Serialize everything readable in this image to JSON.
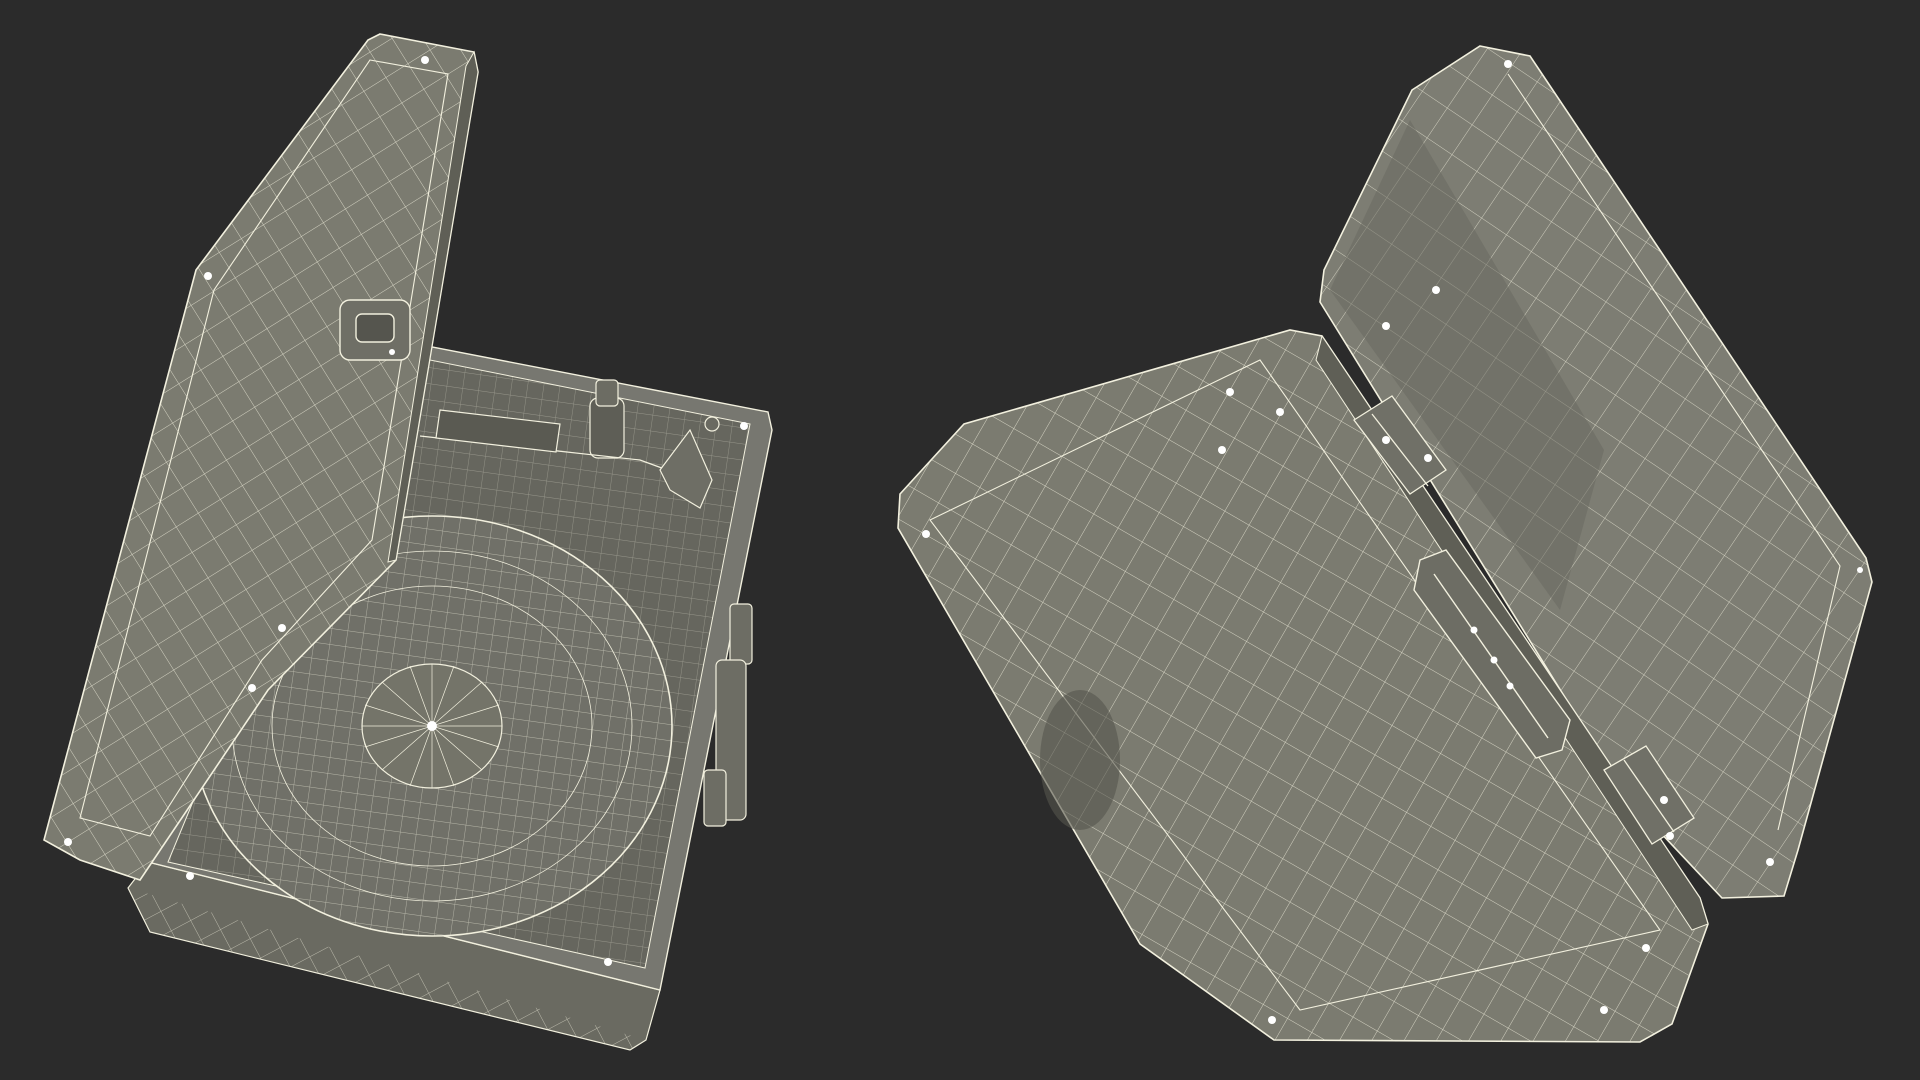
{
  "scene": {
    "background": "#2b2b2b",
    "surface_color": "#7b7b70",
    "surface_shadow": "#5f5f56",
    "surface_dark": "#4e4e47",
    "wire_color": "#f2f0de",
    "screw_color": "#ffffff"
  },
  "objects": [
    {
      "name": "open-turntable-case-front-view",
      "icon": "turntable-case-icon"
    },
    {
      "name": "closed-suitcase-back-view",
      "icon": "suitcase-icon"
    }
  ]
}
